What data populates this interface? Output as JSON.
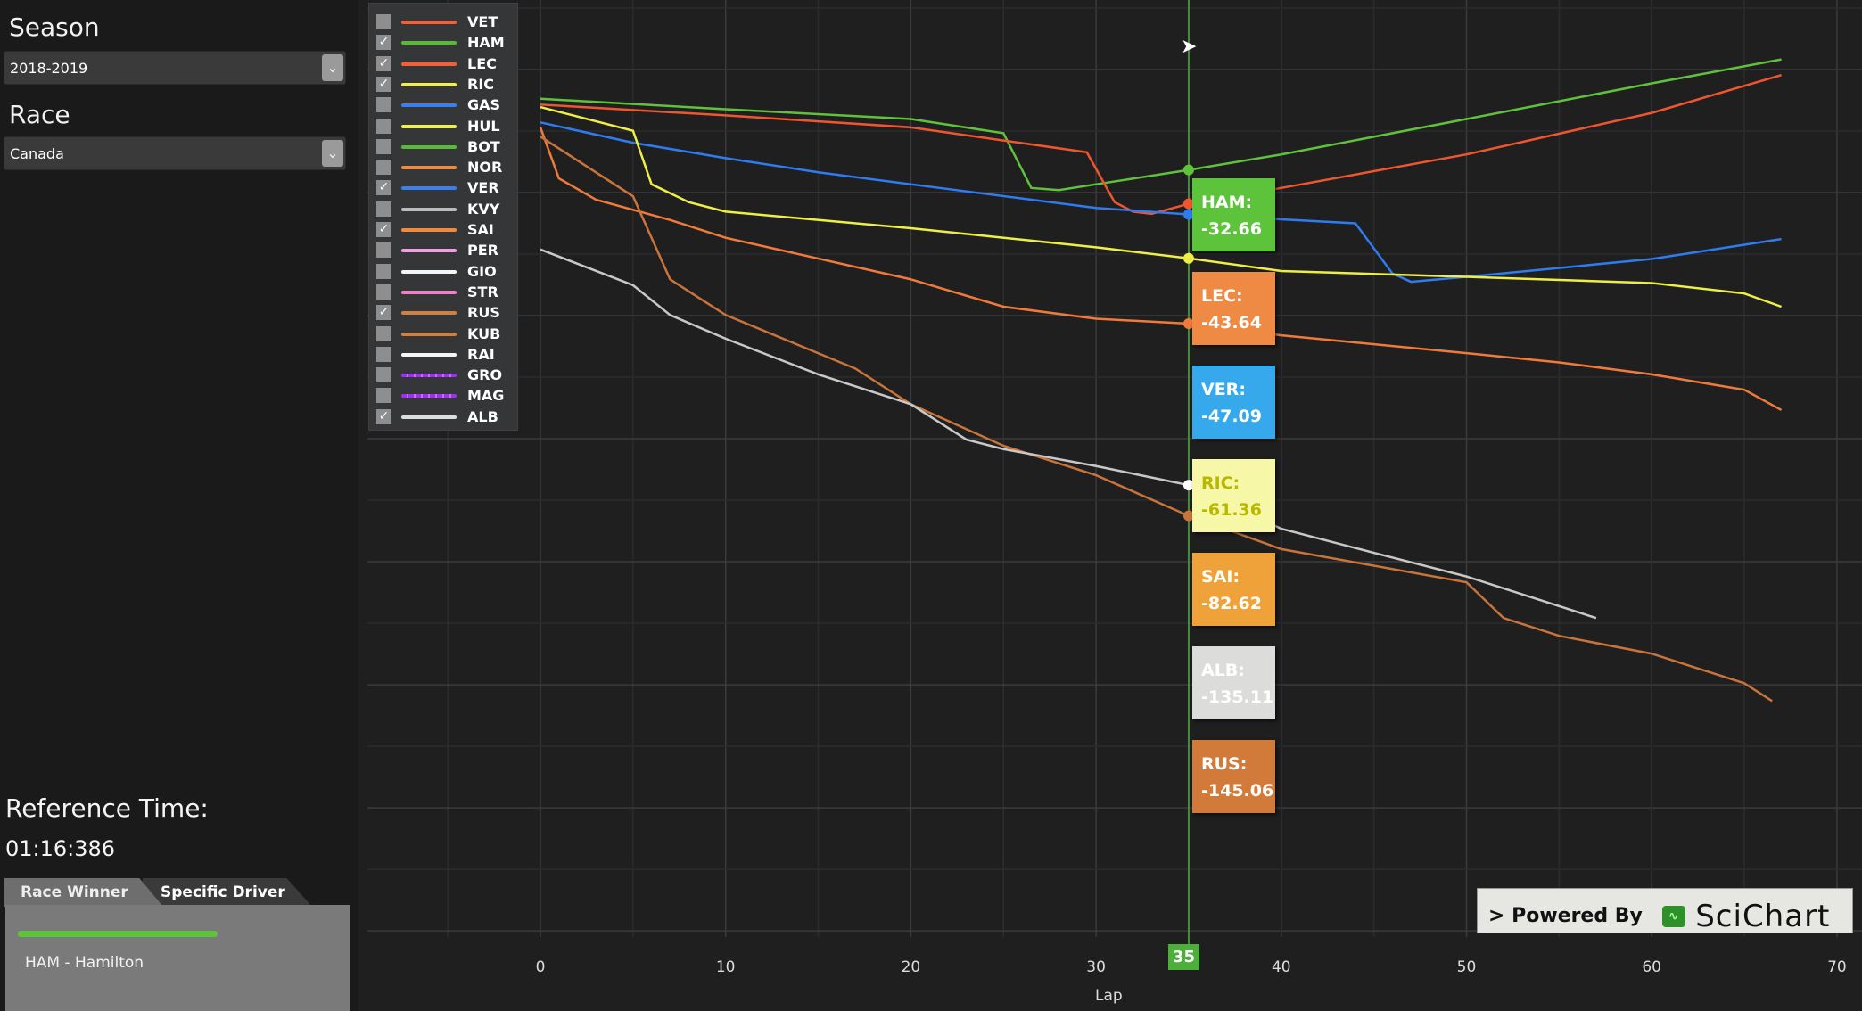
{
  "sidebar": {
    "season_label": "Season",
    "season_value": "2018-2019",
    "race_label": "Race",
    "race_value": "Canada",
    "reference_label": "Reference Time:",
    "reference_time": "01:16:386",
    "tabs": [
      "Race Winner",
      "Specific Driver"
    ],
    "winner": "HAM - Hamilton",
    "dropdown_icon": "chevron-down-icon"
  },
  "legend": [
    {
      "code": "VET",
      "color": "#f0603a",
      "checked": false
    },
    {
      "code": "HAM",
      "color": "#5ab83a",
      "checked": true
    },
    {
      "code": "LEC",
      "color": "#f0603a",
      "checked": true
    },
    {
      "code": "RIC",
      "color": "#eeee55",
      "checked": true
    },
    {
      "code": "GAS",
      "color": "#3a7ef0",
      "checked": false
    },
    {
      "code": "HUL",
      "color": "#eeee55",
      "checked": false
    },
    {
      "code": "BOT",
      "color": "#5ab83a",
      "checked": false
    },
    {
      "code": "NOR",
      "color": "#f08a40",
      "checked": false
    },
    {
      "code": "VER",
      "color": "#3a7ef0",
      "checked": true
    },
    {
      "code": "KVY",
      "color": "#bbbbbb",
      "checked": false
    },
    {
      "code": "SAI",
      "color": "#f08a40",
      "checked": true
    },
    {
      "code": "PER",
      "color": "#f0a0e0",
      "checked": false
    },
    {
      "code": "GIO",
      "color": "#f5f5f5",
      "checked": false
    },
    {
      "code": "STR",
      "color": "#f080c8",
      "checked": false
    },
    {
      "code": "RUS",
      "color": "#d08040",
      "checked": true
    },
    {
      "code": "KUB",
      "color": "#d08040",
      "checked": false
    },
    {
      "code": "RAI",
      "color": "#f5f5f5",
      "checked": false
    },
    {
      "code": "GRO",
      "color": "#a030f0",
      "checked": false
    },
    {
      "code": "MAG",
      "color": "#a030f0",
      "checked": false
    },
    {
      "code": "ALB",
      "color": "#dddddd",
      "checked": true
    }
  ],
  "tooltips": [
    {
      "label": "HAM:",
      "value": "-32.66",
      "bg": "#5cc33a",
      "fg": "#ffffff"
    },
    {
      "label": "LEC:",
      "value": "-43.64",
      "bg": "#ef8a45",
      "fg": "#ffffff"
    },
    {
      "label": "VER:",
      "value": "-47.09",
      "bg": "#36a8ec",
      "fg": "#ffffff"
    },
    {
      "label": "RIC:",
      "value": "-61.36",
      "bg": "#f7f7a8",
      "fg": "#b8b800"
    },
    {
      "label": "SAI:",
      "value": "-82.62",
      "bg": "#f0a23a",
      "fg": "#ffffff"
    },
    {
      "label": "ALB:",
      "value": "-135.11",
      "bg": "#dcdcda",
      "fg": "#ffffff"
    },
    {
      "label": "RUS:",
      "value": "-145.06",
      "bg": "#d17a3a",
      "fg": "#ffffff"
    }
  ],
  "cursor_lap": "35",
  "watermark": {
    "prefix": "> Powered By",
    "brand": "SciChart"
  },
  "chart_data": {
    "type": "line",
    "xlabel": "Lap",
    "ylabel": "",
    "xlim": [
      -9.5,
      70
    ],
    "ylim": [
      -282,
      22.6
    ],
    "xticks": [
      0,
      10,
      20,
      30,
      40,
      50,
      60,
      70
    ],
    "grid": true,
    "series": [
      {
        "name": "HAM",
        "color": "#5fc23a",
        "x": [
          0,
          10,
          20,
          25,
          26.5,
          28,
          30,
          35,
          40,
          50,
          60,
          67
        ],
        "y": [
          -9.5,
          -12.9,
          -16.1,
          -20.7,
          -38.5,
          -39.2,
          -37.3,
          -32.66,
          -27.6,
          -16.1,
          -4.5,
          3.3
        ]
      },
      {
        "name": "LEC",
        "color": "#f0562e",
        "x": [
          0,
          10,
          20,
          29.5,
          31,
          32,
          33,
          35,
          40,
          50,
          60,
          67
        ],
        "y": [
          -11.4,
          -14.9,
          -18.8,
          -26.9,
          -43.1,
          -46.2,
          -46.9,
          -43.64,
          -38.5,
          -27.6,
          -14.1,
          -1.8
        ]
      },
      {
        "name": "VER",
        "color": "#2f7bf0",
        "x": [
          0,
          5,
          10,
          15,
          20,
          30,
          35,
          44,
          46,
          47,
          50,
          60,
          67
        ],
        "y": [
          -17.2,
          -23.8,
          -28.8,
          -33.4,
          -37.3,
          -45.0,
          -47.09,
          -50.0,
          -66.3,
          -69.0,
          -67.4,
          -61.6,
          -55.1
        ]
      },
      {
        "name": "RIC",
        "color": "#eeee44",
        "x": [
          0,
          5,
          6,
          8,
          10,
          20,
          30,
          35,
          40,
          50,
          60,
          65,
          67
        ],
        "y": [
          -12.2,
          -19.9,
          -37.3,
          -43.1,
          -46.2,
          -51.6,
          -57.8,
          -61.36,
          -65.5,
          -67.4,
          -69.4,
          -72.8,
          -77.1
        ]
      },
      {
        "name": "SAI",
        "color": "#f07a3a",
        "x": [
          0,
          1,
          3,
          7,
          10,
          20,
          25,
          30,
          35,
          40,
          50,
          55,
          60,
          65,
          67
        ],
        "y": [
          -18.8,
          -35.4,
          -42.3,
          -48.9,
          -54.7,
          -68.2,
          -77.1,
          -81.0,
          -82.62,
          -86.4,
          -92.2,
          -95.2,
          -99.1,
          -104.1,
          -110.7
        ]
      },
      {
        "name": "RUS",
        "color": "#c8743a",
        "x": [
          0,
          5,
          7,
          10,
          17,
          20,
          25,
          30,
          35,
          40,
          50,
          52,
          55,
          60,
          65,
          66.5
        ],
        "y": [
          -21.8,
          -41.2,
          -68.2,
          -79.8,
          -97.2,
          -108.8,
          -122.3,
          -131.9,
          -145.06,
          -155.9,
          -166.7,
          -178.3,
          -184.1,
          -189.9,
          -199.5,
          -205.3
        ]
      },
      {
        "name": "ALB",
        "color": "#c8c8c8",
        "x": [
          0,
          5,
          7,
          10,
          15,
          20,
          23,
          25,
          30,
          35,
          40,
          45,
          50,
          57
        ],
        "y": [
          -58.5,
          -70.1,
          -79.8,
          -87.5,
          -99.1,
          -108.8,
          -120.3,
          -123.4,
          -128.9,
          -135.11,
          -149.3,
          -157.1,
          -164.8,
          -178.3
        ]
      }
    ]
  }
}
